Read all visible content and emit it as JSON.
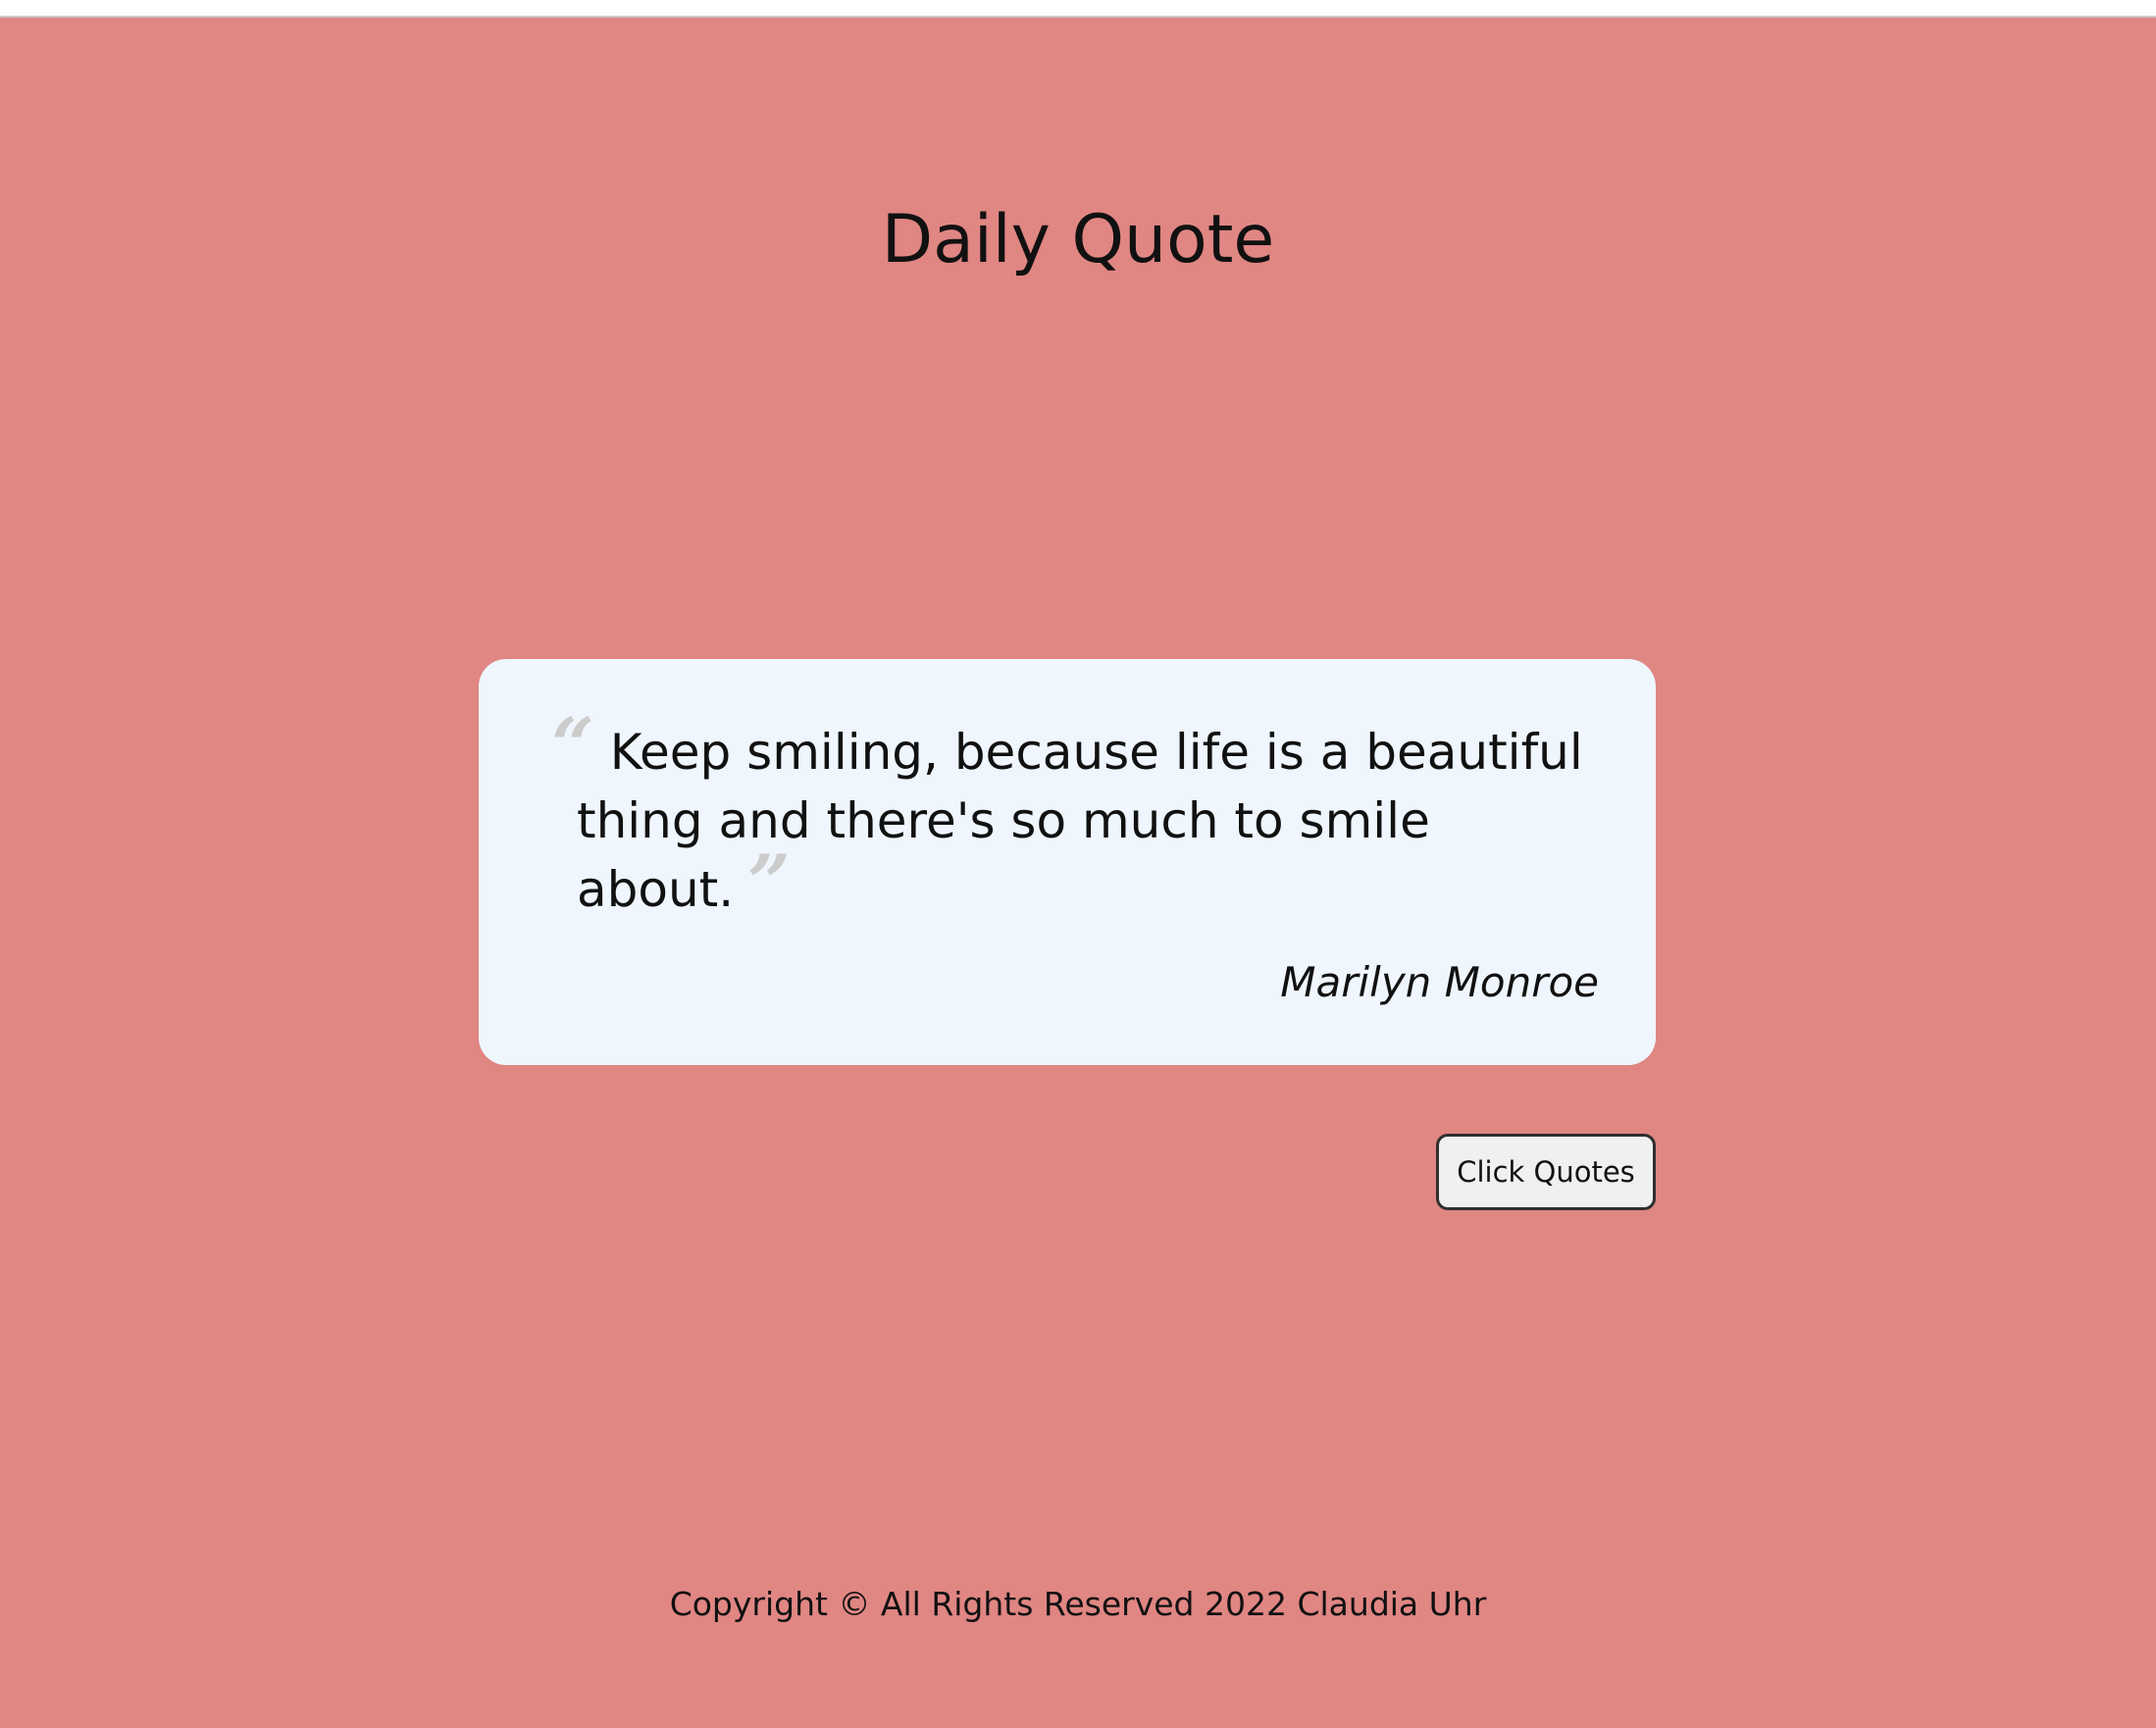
{
  "header": {
    "title": "Daily Quote"
  },
  "quote": {
    "open_mark_icon": "opening-quote-mark",
    "close_mark_icon": "closing-quote-mark",
    "open_mark": "“",
    "close_mark": "”",
    "text": "Keep smiling, because life is a beautiful thing and there's so much to smile about.",
    "author": "Marilyn Monroe"
  },
  "actions": {
    "next_quote_label": "Click Quotes"
  },
  "footer": {
    "copyright": "Copyright © All Rights Reserved 2022 Claudia Uhr"
  },
  "colors": {
    "page_background": "#e08683",
    "card_background": "#eff6fd",
    "quote_mark": "#cccccc",
    "button_background": "#f0f0f0",
    "text": "#111111"
  }
}
